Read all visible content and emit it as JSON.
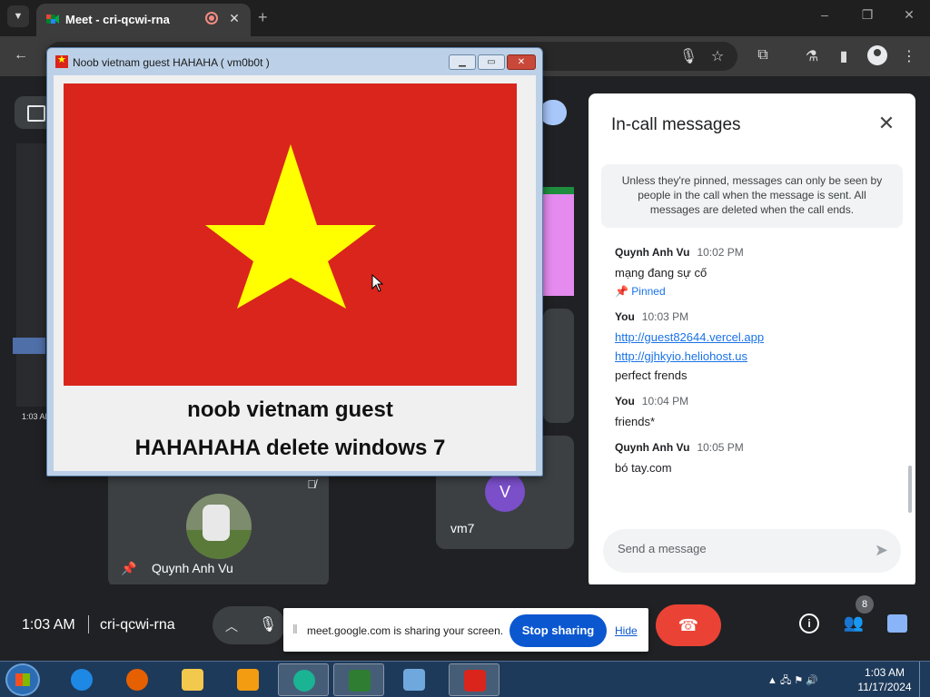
{
  "browser": {
    "tab_title": "Meet - cri-qcwi-rna",
    "new_tab_label": "+",
    "window_controls": [
      "–",
      "❐",
      "✕"
    ]
  },
  "win7_dialog": {
    "title": "Noob vietnam guest HAHAHA ( vm0b0t )",
    "caption_line1": "noob vietnam guest",
    "caption_line2": "HAHAHAHA delete windows 7",
    "flag_colors": {
      "field": "#da251d",
      "star": "#ffff00"
    }
  },
  "meet": {
    "participant_tiles": [
      {
        "name": "Quynh Anh Vu"
      },
      {
        "name": "vm7",
        "initial": "V"
      }
    ],
    "thumb_time": "1:03 AM"
  },
  "chat": {
    "title": "In-call messages",
    "close_label": "✕",
    "notice": "Unless they're pinned, messages can only be seen by people in the call when the message is sent. All messages are deleted when the call ends.",
    "messages": [
      {
        "sender": "Quynh Anh Vu",
        "time": "10:02 PM",
        "lines": [
          "mạng đang sự cố"
        ],
        "pinned": "Pinned"
      },
      {
        "sender": "You",
        "time": "10:03 PM",
        "links": [
          "http://guest82644.vercel.app",
          "http://gjhkyio.heliohost.us"
        ],
        "lines": [
          "perfect frends"
        ]
      },
      {
        "sender": "You",
        "time": "10:04 PM",
        "lines": [
          "friends*"
        ]
      },
      {
        "sender": "Quynh Anh Vu",
        "time": "10:05 PM",
        "lines": [
          "bó tay.com"
        ]
      }
    ],
    "input_placeholder": "Send a message"
  },
  "bottom_bar": {
    "clock": "1:03 AM",
    "meeting_code": "cri-qcwi-rna",
    "participants_count": "8"
  },
  "share_bar": {
    "text": "meet.google.com is sharing your screen.",
    "stop_label": "Stop sharing",
    "hide_label": "Hide"
  },
  "taskbar": {
    "time": "1:03 AM",
    "date": "11/17/2024"
  }
}
